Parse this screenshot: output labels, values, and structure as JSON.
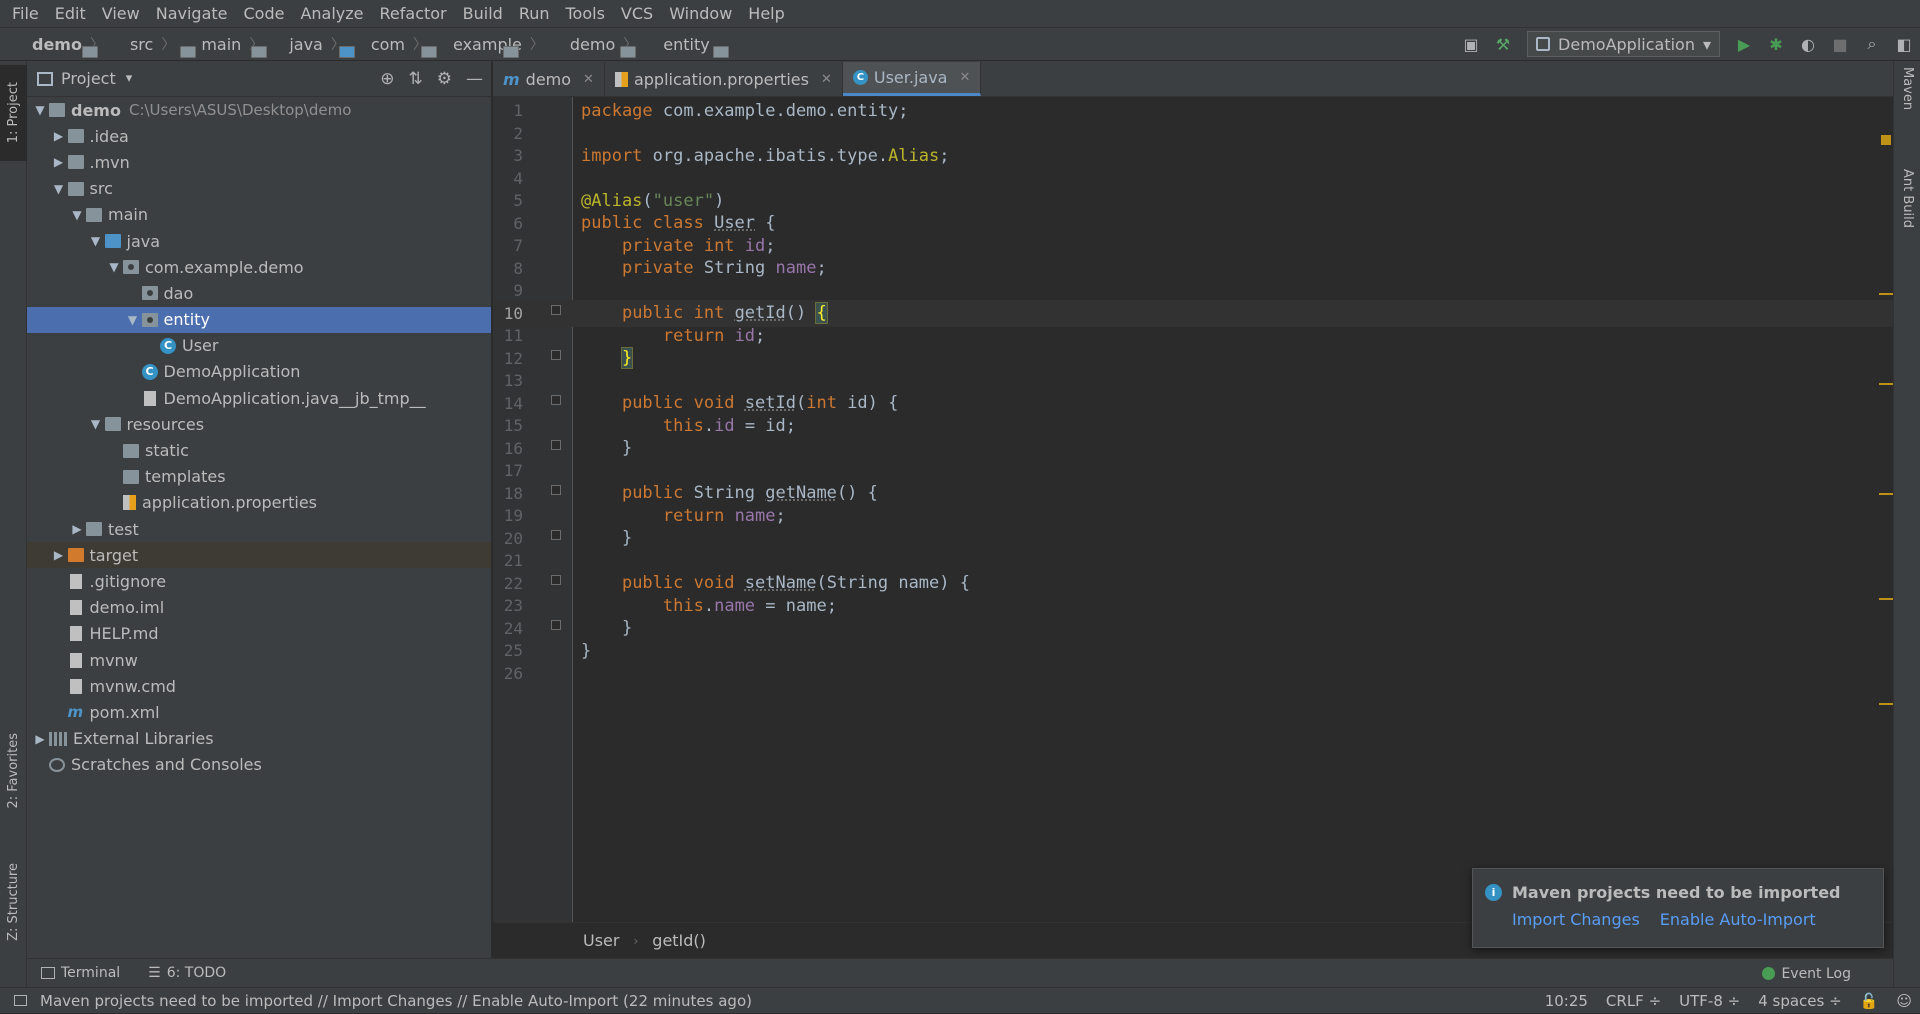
{
  "menu": [
    "File",
    "Edit",
    "View",
    "Navigate",
    "Code",
    "Analyze",
    "Refactor",
    "Build",
    "Run",
    "Tools",
    "VCS",
    "Window",
    "Help"
  ],
  "breadcrumbs": [
    "demo",
    "src",
    "main",
    "java",
    "com",
    "example",
    "demo",
    "entity"
  ],
  "toolbar": {
    "run_config": "DemoApplication"
  },
  "left_strip": {
    "project": "1: Project",
    "favorites": "2: Favorites",
    "structure": "Z: Structure"
  },
  "right_strip": {
    "maven": "Maven",
    "ant": "Ant Build"
  },
  "project_panel": {
    "title": "Project"
  },
  "tree": [
    {
      "indent": 0,
      "arrow": "down",
      "icon": "folder",
      "label": "demo",
      "bold": true,
      "sub": "C:\\Users\\ASUS\\Desktop\\demo"
    },
    {
      "indent": 1,
      "arrow": "right",
      "icon": "folder",
      "label": ".idea"
    },
    {
      "indent": 1,
      "arrow": "right",
      "icon": "folder",
      "label": ".mvn"
    },
    {
      "indent": 1,
      "arrow": "down",
      "icon": "folder",
      "label": "src"
    },
    {
      "indent": 2,
      "arrow": "down",
      "icon": "folder",
      "label": "main"
    },
    {
      "indent": 3,
      "arrow": "down",
      "icon": "folder-blue",
      "label": "java"
    },
    {
      "indent": 4,
      "arrow": "down",
      "icon": "pkg",
      "label": "com.example.demo"
    },
    {
      "indent": 5,
      "arrow": "",
      "icon": "pkg",
      "label": "dao"
    },
    {
      "indent": 5,
      "arrow": "down",
      "icon": "pkg",
      "label": "entity",
      "selected": true
    },
    {
      "indent": 6,
      "arrow": "",
      "icon": "cls",
      "label": "User"
    },
    {
      "indent": 5,
      "arrow": "",
      "icon": "cls",
      "label": "DemoApplication"
    },
    {
      "indent": 5,
      "arrow": "",
      "icon": "file",
      "label": "DemoApplication.java__jb_tmp__"
    },
    {
      "indent": 3,
      "arrow": "down",
      "icon": "res",
      "label": "resources"
    },
    {
      "indent": 4,
      "arrow": "",
      "icon": "folder",
      "label": "static"
    },
    {
      "indent": 4,
      "arrow": "",
      "icon": "folder",
      "label": "templates"
    },
    {
      "indent": 4,
      "arrow": "",
      "icon": "prop",
      "label": "application.properties"
    },
    {
      "indent": 2,
      "arrow": "right",
      "icon": "folder",
      "label": "test"
    },
    {
      "indent": 1,
      "arrow": "right",
      "icon": "folder-orange",
      "label": "target",
      "ignored": true
    },
    {
      "indent": 1,
      "arrow": "",
      "icon": "file",
      "label": ".gitignore"
    },
    {
      "indent": 1,
      "arrow": "",
      "icon": "file",
      "label": "demo.iml"
    },
    {
      "indent": 1,
      "arrow": "",
      "icon": "file",
      "label": "HELP.md"
    },
    {
      "indent": 1,
      "arrow": "",
      "icon": "file",
      "label": "mvnw"
    },
    {
      "indent": 1,
      "arrow": "",
      "icon": "file",
      "label": "mvnw.cmd"
    },
    {
      "indent": 1,
      "arrow": "",
      "icon": "maven",
      "label": "pom.xml"
    },
    {
      "indent": 0,
      "arrow": "right",
      "icon": "lib",
      "label": "External Libraries"
    },
    {
      "indent": 0,
      "arrow": "",
      "icon": "scratch",
      "label": "Scratches and Consoles"
    }
  ],
  "tabs": [
    {
      "icon": "maven",
      "label": "demo"
    },
    {
      "icon": "prop",
      "label": "application.properties"
    },
    {
      "icon": "cls",
      "label": "User.java",
      "active": true
    }
  ],
  "code_lines": [
    {
      "n": "1",
      "html": "<span class='kw'>package</span> com.example.demo.entity;"
    },
    {
      "n": "2",
      "html": ""
    },
    {
      "n": "3",
      "html": "<span class='kw'>import</span> org.apache.ibatis.type.<span class='ann'>Alias</span>;"
    },
    {
      "n": "4",
      "html": ""
    },
    {
      "n": "5",
      "html": "<span class='ann'>@Alias</span>(<span class='str'>\"user\"</span>)"
    },
    {
      "n": "6",
      "html": "<span class='kw'>public class</span> <span class='fn'>User</span> {"
    },
    {
      "n": "7",
      "html": "    <span class='kw'>private int</span> <span class='fld'>id</span>;"
    },
    {
      "n": "8",
      "html": "    <span class='kw'>private</span> String <span class='fld'>name</span>;"
    },
    {
      "n": "9",
      "html": ""
    },
    {
      "n": "10",
      "html": "    <span class='kw'>public int</span> <span class='fn'>getId</span>() <span class='brk'>{</span>",
      "current": true
    },
    {
      "n": "11",
      "html": "        <span class='kw'>return</span> <span class='fld'>id</span>;"
    },
    {
      "n": "12",
      "html": "    <span class='brk'>}</span>"
    },
    {
      "n": "13",
      "html": ""
    },
    {
      "n": "14",
      "html": "    <span class='kw'>public void</span> <span class='fn'>setId</span>(<span class='kw'>int</span> id) {"
    },
    {
      "n": "15",
      "html": "        <span class='kw'>this</span>.<span class='fld'>id</span> = id;"
    },
    {
      "n": "16",
      "html": "    }"
    },
    {
      "n": "17",
      "html": ""
    },
    {
      "n": "18",
      "html": "    <span class='kw'>public</span> String <span class='fn'>getName</span>() {"
    },
    {
      "n": "19",
      "html": "        <span class='kw'>return</span> <span class='fld'>name</span>;"
    },
    {
      "n": "20",
      "html": "    }"
    },
    {
      "n": "21",
      "html": ""
    },
    {
      "n": "22",
      "html": "    <span class='kw'>public void</span> <span class='fn'>setName</span>(String name) {"
    },
    {
      "n": "23",
      "html": "        <span class='kw'>this</span>.<span class='fld'>name</span> = name;"
    },
    {
      "n": "24",
      "html": "    }"
    },
    {
      "n": "25",
      "html": "}"
    },
    {
      "n": "26",
      "html": ""
    }
  ],
  "code_breadcrumb": [
    "User",
    "getId()"
  ],
  "notification": {
    "title": "Maven projects need to be imported",
    "link1": "Import Changes",
    "link2": "Enable Auto-Import"
  },
  "tool_windows": {
    "terminal": "Terminal",
    "todo": "6: TODO",
    "event_log": "Event Log"
  },
  "status": {
    "message": "Maven projects need to be imported // Import Changes // Enable Auto-Import (22 minutes ago)",
    "position": "10:25",
    "line_sep": "CRLF ÷",
    "encoding": "UTF-8 ÷",
    "indent": "4 spaces ÷"
  }
}
